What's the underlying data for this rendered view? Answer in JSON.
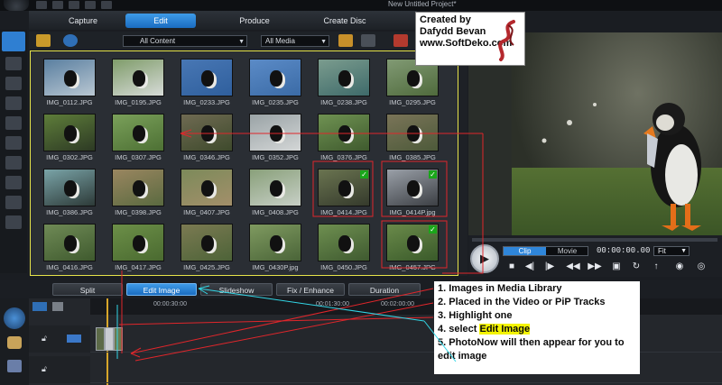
{
  "window": {
    "title": "New Untitled Project*"
  },
  "mode_tabs": [
    {
      "label": "Capture",
      "active": false
    },
    {
      "label": "Edit",
      "active": true
    },
    {
      "label": "Produce",
      "active": false
    },
    {
      "label": "Create Disc",
      "active": false
    }
  ],
  "library_toolbar": {
    "content_filter": "All Content",
    "media_filter": "All Media"
  },
  "library": {
    "items": [
      {
        "name": "IMG_0112.JPG",
        "colors": [
          "#5a7fa0",
          "#b9c7d2"
        ],
        "checked": false
      },
      {
        "name": "IMG_0195.JPG",
        "colors": [
          "#7f9c6a",
          "#d7dbd8"
        ],
        "checked": false
      },
      {
        "name": "IMG_0233.JPG",
        "colors": [
          "#4877b4",
          "#2f5f9d"
        ],
        "checked": false
      },
      {
        "name": "IMG_0235.JPG",
        "colors": [
          "#5b8bc7",
          "#3b6ba6"
        ],
        "checked": false
      },
      {
        "name": "IMG_0238.JPG",
        "colors": [
          "#7b9c8e",
          "#3e6a6a"
        ],
        "checked": false
      },
      {
        "name": "IMG_0295.JPG",
        "colors": [
          "#819a74",
          "#4f6a3c"
        ],
        "checked": false
      },
      {
        "name": "IMG_0302.JPG",
        "colors": [
          "#5e7d3a",
          "#2d3a24"
        ],
        "checked": false
      },
      {
        "name": "IMG_0307.JPG",
        "colors": [
          "#7aa05a",
          "#4d7034"
        ],
        "checked": false
      },
      {
        "name": "IMG_0346.JPG",
        "colors": [
          "#6f6a52",
          "#3e4a2c"
        ],
        "checked": false
      },
      {
        "name": "IMG_0352.JPG",
        "colors": [
          "#9aa3a6",
          "#d3d6d6"
        ],
        "checked": false
      },
      {
        "name": "IMG_0376.JPG",
        "colors": [
          "#6f9252",
          "#3f5a2e"
        ],
        "checked": false
      },
      {
        "name": "IMG_0385.JPG",
        "colors": [
          "#7a7458",
          "#4d5a3a"
        ],
        "checked": false
      },
      {
        "name": "IMG_0386.JPG",
        "colors": [
          "#7aa4a8",
          "#2d3a38"
        ],
        "checked": false
      },
      {
        "name": "IMG_0398.JPG",
        "colors": [
          "#9a8660",
          "#5a6a40"
        ],
        "checked": false
      },
      {
        "name": "IMG_0407.JPG",
        "colors": [
          "#7c8a5a",
          "#a38f6a"
        ],
        "checked": false
      },
      {
        "name": "IMG_0408.JPG",
        "colors": [
          "#89a07a",
          "#c7cfc6"
        ],
        "checked": false
      },
      {
        "name": "IMG_0414.JPG",
        "colors": [
          "#6a7450",
          "#353a2c"
        ],
        "checked": true
      },
      {
        "name": "IMG_0414P.jpg",
        "colors": [
          "#9aa0a8",
          "#3c3f44"
        ],
        "checked": true
      },
      {
        "name": "IMG_0416.JPG",
        "colors": [
          "#6f8a56",
          "#3f5a2e"
        ],
        "checked": false
      },
      {
        "name": "IMG_0417.JPG",
        "colors": [
          "#6c8f48",
          "#4a6a30"
        ],
        "checked": false
      },
      {
        "name": "IMG_0425.JPG",
        "colors": [
          "#7b7a52",
          "#4d6338"
        ],
        "checked": false
      },
      {
        "name": "IMG_0430P.jpg",
        "colors": [
          "#7f9a60",
          "#4a6438"
        ],
        "checked": false
      },
      {
        "name": "IMG_0450.JPG",
        "colors": [
          "#6e8f50",
          "#3f5a30"
        ],
        "checked": false
      },
      {
        "name": "IMG_0457.JPG",
        "colors": [
          "#6a8a4a",
          "#3a5a2a"
        ],
        "checked": true
      }
    ]
  },
  "playback": {
    "clip_label": "Clip",
    "movie_label": "Movie",
    "timecode": "00:00:00.00",
    "zoom": "Fit",
    "buttons": [
      "stop-icon",
      "previous-frame-icon",
      "next-frame-icon",
      "previous-icon",
      "fast-forward-icon",
      "snapshot-icon",
      "loop-icon",
      "mute-icon",
      "volume-icon",
      "3d-icon"
    ]
  },
  "edit_toolbar": [
    {
      "label": "Split",
      "active": false
    },
    {
      "label": "Edit Image",
      "active": true
    },
    {
      "label": "Slideshow",
      "active": false
    },
    {
      "label": "Fix / Enhance",
      "active": false
    },
    {
      "label": "Duration",
      "active": false
    }
  ],
  "timeline": {
    "ruler": [
      "00:00:00:00",
      "00:00:30:00",
      "00:01:00:00",
      "00:01:30:00",
      "00:02:00:00"
    ]
  },
  "credit": {
    "line1": "Created by",
    "line2": "Dafydd Bevan",
    "line3": "www.SoftDeko.com"
  },
  "instructions": {
    "step1": "1. Images in Media Library",
    "step2": "2. Placed in the Video or PiP Tracks",
    "step3": "3. Highlight one",
    "step4_prefix": "4. select ",
    "step4_highlight": "Edit Image",
    "step5": "5. PhotoNow will then appear for you to edit image"
  },
  "colors": {
    "accent": "#2f86da",
    "annotation_red": "#e0262b",
    "annotation_cyan": "#32d6e6",
    "selection_yellow": "#e6e34a"
  }
}
